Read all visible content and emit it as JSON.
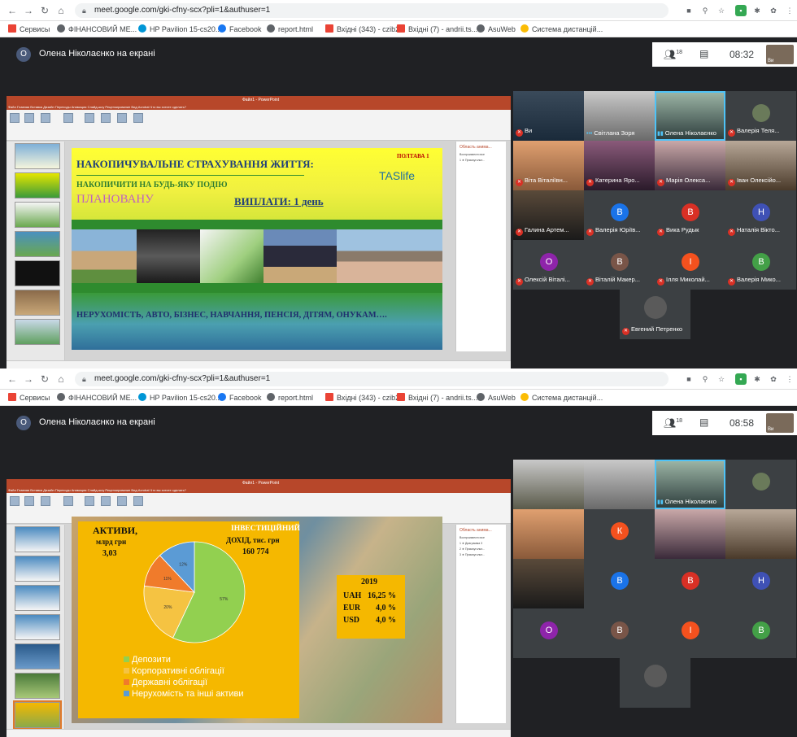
{
  "browser": {
    "url": "meet.google.com/gki-cfny-scx?pli=1&authuser=1",
    "bookmarks": [
      "Сервисы",
      "ФІНАНСОВИЙ МЕ...",
      "HP Pavilion 15-cs20...",
      "Facebook",
      "report.html",
      "Вхідні (343) - czib2...",
      "Вхідні (7) - andrii.ts...",
      "AsuWeb",
      "Система дистанцій..."
    ]
  },
  "meet_header": {
    "presenter_initial": "О",
    "presenter_text": "Олена Ніколаєнко на екрані",
    "people_count": "18",
    "self_label": "Ви"
  },
  "screenshots": [
    {
      "time": "08:32",
      "ppt": {
        "title": "Файл1 - PowerPoint",
        "menu": "Файл   Главная   Вставка   Дизайн   Переходы   Анимация   Слайд-шоу   Рецензирование   Вид   Acrobat   Что вы хотите сделать?",
        "anim_title": "Область анима...",
        "anim_items": [
          "Воспроизвести все",
          "1 ★ Прямоугольн..."
        ]
      },
      "slide": {
        "title": "НАКОПИЧУВАЛЬНЕ  СТРАХУВАННЯ  ЖИТТЯ:",
        "corner_badge": "ПОЛТАВА 1",
        "brand": "TASlife",
        "line2": "НАКОПИЧИТИ    НА БУДЬ-ЯКУ ПОДІЮ",
        "line3": "ПЛАНОВАНУ",
        "payout": "ВИПЛАТИ:   1 день",
        "footer": "НЕРУХОМІСТЬ, АВТО, БІЗНЕС, НАВЧАННЯ, ПЕНСІЯ, ДІТЯМ,  ОНУКАМ…."
      },
      "participants": [
        {
          "name": "Ви",
          "muted": true
        },
        {
          "name": "Світлана Зоря",
          "muted": false
        },
        {
          "name": "Олена Ніколаєнко",
          "muted": false,
          "speaking": true
        },
        {
          "name": "Валерія Теля...",
          "muted": true
        },
        {
          "name": "Віта Віталіївн...",
          "muted": true
        },
        {
          "name": "Катерина Яро...",
          "muted": true
        },
        {
          "name": "Марія Олекса...",
          "muted": true
        },
        {
          "name": "Іван Олексійо...",
          "muted": true
        },
        {
          "name": "Галина Артем...",
          "muted": true
        },
        {
          "name": "Валерія Юріїв...",
          "muted": true,
          "initial": "В",
          "color": "#1a73e8"
        },
        {
          "name": "Вика Рудык",
          "muted": true,
          "initial": "В",
          "color": "#d93025"
        },
        {
          "name": "Наталія Вікто...",
          "muted": true,
          "initial": "Н",
          "color": "#3f51b5"
        },
        {
          "name": "Олексій Віталі...",
          "muted": true,
          "initial": "О",
          "color": "#8e24aa"
        },
        {
          "name": "Віталій Макер...",
          "muted": true,
          "initial": "В",
          "color": "#795548"
        },
        {
          "name": "Ілля Миколай...",
          "muted": true,
          "initial": "І",
          "color": "#f4511e"
        },
        {
          "name": "Валерія Мико...",
          "muted": true,
          "initial": "В",
          "color": "#43a047"
        },
        {
          "name": "Евгений Петренко",
          "muted": true
        }
      ]
    },
    {
      "time": "08:58",
      "ppt": {
        "title": "Файл1 - PowerPoint",
        "menu": "Файл   Главная   Вставка   Дизайн   Переходы   Анимация   Слайд-шоу   Рецензирование   Вид   Acrobat   Что вы хотите сделать?",
        "anim_title": "Область анима...",
        "anim_items": [
          "Воспроизвести все",
          "1 ★ Диаграмма 3",
          "2 ★ Прямоугольн...",
          "3 ★ Прямоугольн..."
        ]
      },
      "slide": {
        "assets_label": "АКТИВИ,",
        "assets_unit": "млрд  грн",
        "assets_value": "3,03",
        "income_label": "ІНВЕСТИЦІЙНИЙ",
        "income_unit": "ДОХІД, тис. грн",
        "income_value": "160 774",
        "year": "2019",
        "rates": [
          {
            "cur": "UAH",
            "val": "16,25 %"
          },
          {
            "cur": "EUR",
            "val": "4,0 %"
          },
          {
            "cur": "USD",
            "val": "4,0 %"
          }
        ]
      },
      "participants": [
        {
          "name": "",
          "muted": false
        },
        {
          "name": "",
          "muted": false
        },
        {
          "name": "Олена Ніколаєнко",
          "muted": false,
          "speaking": true
        },
        {
          "name": "",
          "muted": false
        },
        {
          "name": "",
          "muted": false
        },
        {
          "name": "",
          "muted": false,
          "initial": "К",
          "color": "#f4511e"
        },
        {
          "name": "",
          "muted": false
        },
        {
          "name": "",
          "muted": false
        },
        {
          "name": "",
          "muted": false
        },
        {
          "name": "",
          "muted": false,
          "initial": "В",
          "color": "#1a73e8"
        },
        {
          "name": "",
          "muted": false,
          "initial": "В",
          "color": "#d93025"
        },
        {
          "name": "",
          "muted": false,
          "initial": "Н",
          "color": "#3f51b5"
        },
        {
          "name": "",
          "muted": false,
          "initial": "О",
          "color": "#8e24aa"
        },
        {
          "name": "",
          "muted": false,
          "initial": "В",
          "color": "#795548"
        },
        {
          "name": "",
          "muted": false,
          "initial": "І",
          "color": "#f4511e"
        },
        {
          "name": "",
          "muted": false,
          "initial": "В",
          "color": "#43a047"
        },
        {
          "name": "",
          "muted": false
        }
      ]
    }
  ],
  "chart_data": {
    "type": "pie",
    "categories": [
      "Депозити",
      "Корпоративні облігації",
      "Державні облігації",
      "Нерухомість та інші активи"
    ],
    "values": [
      57,
      20,
      11,
      12
    ],
    "data_labels": [
      "57%",
      "20%",
      "11%",
      "12%"
    ],
    "colors": [
      "#92d050",
      "#f5c342",
      "#f07b2b",
      "#5b9bd5"
    ],
    "legend": "bottom"
  }
}
